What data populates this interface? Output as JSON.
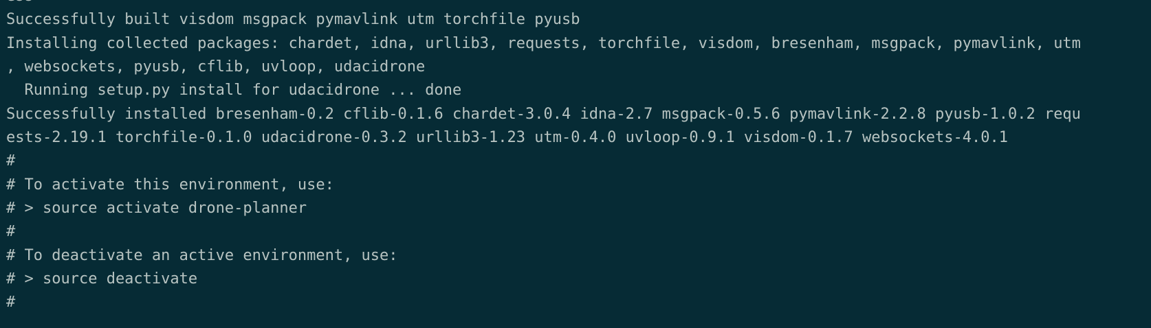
{
  "terminal": {
    "lines": [
      "ess",
      "Successfully built visdom msgpack pymavlink utm torchfile pyusb",
      "Installing collected packages: chardet, idna, urllib3, requests, torchfile, visdom, bresenham, msgpack, pymavlink, utm",
      ", websockets, pyusb, cflib, uvloop, udacidrone",
      "  Running setup.py install for udacidrone ... done",
      "Successfully installed bresenham-0.2 cflib-0.1.6 chardet-3.0.4 idna-2.7 msgpack-0.5.6 pymavlink-2.2.8 pyusb-1.0.2 requ",
      "ests-2.19.1 torchfile-0.1.0 udacidrone-0.3.2 urllib3-1.23 utm-0.4.0 uvloop-0.9.1 visdom-0.1.7 websockets-4.0.1",
      "#",
      "# To activate this environment, use:",
      "# > source activate drone-planner",
      "#",
      "# To deactivate an active environment, use:",
      "# > source deactivate",
      "#"
    ]
  },
  "colors": {
    "background": "#062b35",
    "text": "#b7c3c1"
  }
}
